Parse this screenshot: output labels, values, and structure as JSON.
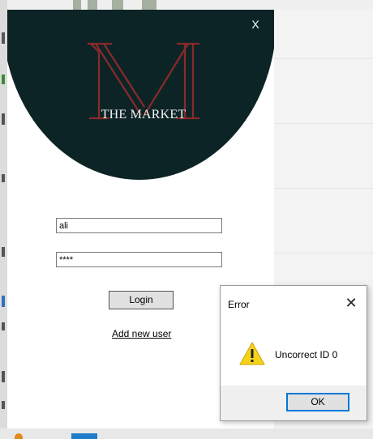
{
  "login_window": {
    "close_label": "X",
    "logo_letter": "M",
    "logo_text": "THE MARKET",
    "username_value": "ali",
    "password_value": "****",
    "login_label": "Login",
    "add_user_label": "Add new user",
    "header_color": "#0d2426",
    "logo_color": "#8a2a2a"
  },
  "error_dialog": {
    "title": "Error",
    "close_label": "✕",
    "icon": "warning-icon",
    "message": "Uncorrect ID 0",
    "ok_label": "OK"
  }
}
